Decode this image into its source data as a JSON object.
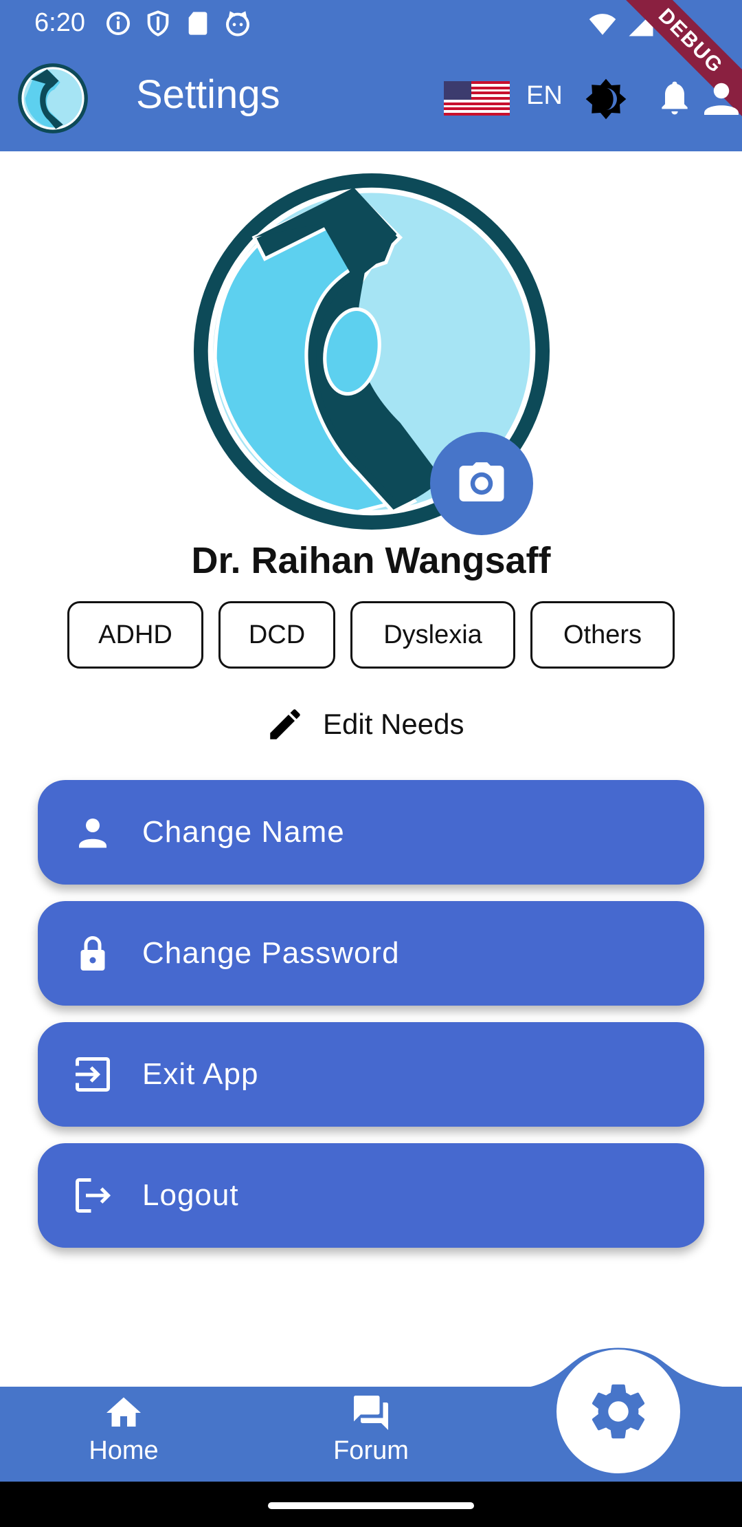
{
  "status_bar": {
    "time": "6:20"
  },
  "debug_banner": "DEBUG",
  "header": {
    "title": "Settings",
    "language": "EN"
  },
  "profile": {
    "name": "Dr. Raihan Wangsaff",
    "needs": [
      "ADHD",
      "DCD",
      "Dyslexia",
      "Others"
    ],
    "edit_needs_label": "Edit Needs"
  },
  "menu": {
    "change_name": "Change Name",
    "change_password": "Change Password",
    "exit_app": "Exit App",
    "logout": "Logout"
  },
  "bottom_nav": {
    "home": "Home",
    "forum": "Forum"
  },
  "colors": {
    "primary": "#4775c9",
    "button": "#4669cf",
    "logo_dark": "#0d4a58",
    "logo_light": "#a6e4f4",
    "logo_mid": "#5dd0ef"
  },
  "icons": [
    "info-icon",
    "shield-icon",
    "sd-card-icon",
    "cat-icon",
    "wifi-icon",
    "signal-icon",
    "battery-icon",
    "us-flag-icon",
    "theme-icon",
    "bell-icon",
    "user-icon",
    "camera-icon",
    "pencil-icon",
    "person-icon",
    "lock-icon",
    "exit-icon",
    "logout-icon",
    "home-icon",
    "forum-icon",
    "gear-icon"
  ]
}
